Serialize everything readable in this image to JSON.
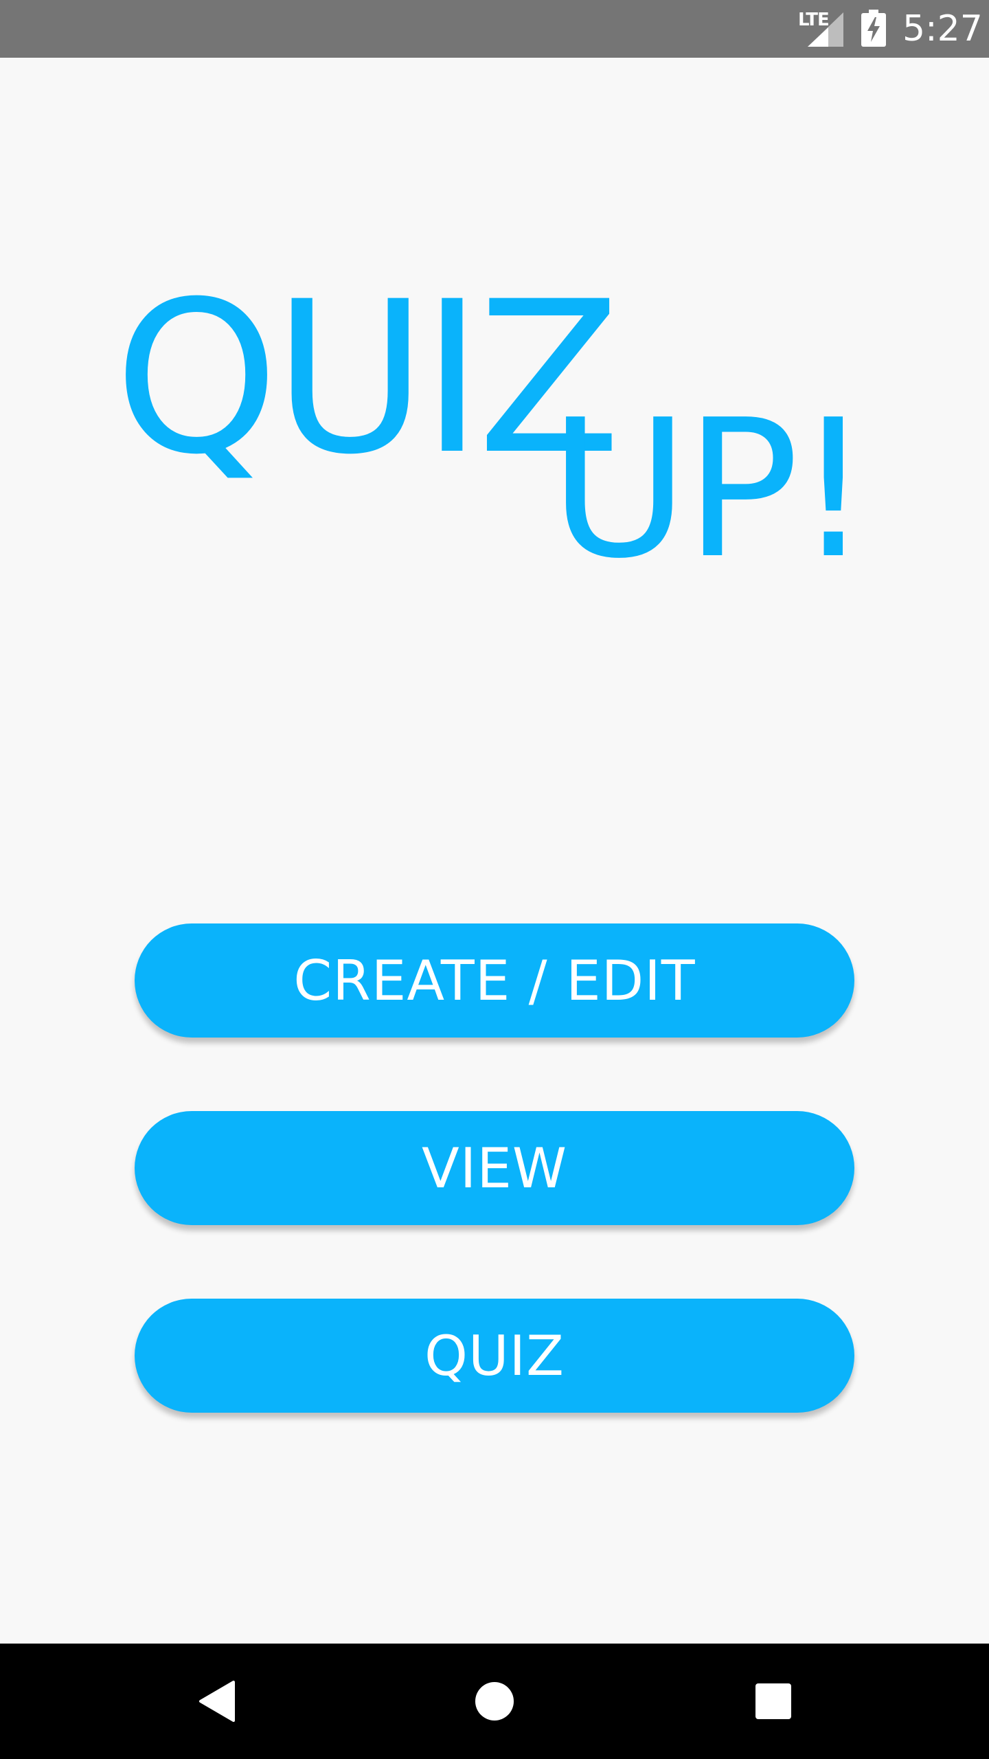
{
  "status_bar": {
    "network": "LTE",
    "time": "5:27",
    "icons": [
      "lte-signal-icon",
      "battery-charging-icon"
    ]
  },
  "title": {
    "line1": "QUIZ",
    "line2": "UP!",
    "color": "#0ab3fb"
  },
  "buttons": {
    "create_edit": "CREATE / EDIT",
    "view": "VIEW",
    "quiz": "QUIZ"
  },
  "nav_bar": {
    "icons": [
      "back-icon",
      "home-icon",
      "recents-icon"
    ]
  },
  "colors": {
    "accent": "#0ab3fb",
    "background": "#f8f8f8",
    "status_bar": "#757575",
    "nav_bar": "#000000"
  }
}
